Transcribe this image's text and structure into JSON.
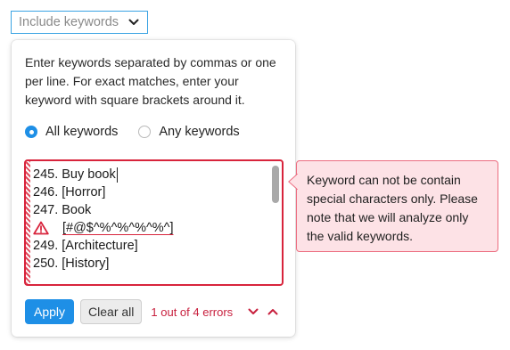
{
  "dropdown": {
    "label": "Include keywords",
    "icon": "chevron-down-icon"
  },
  "panel": {
    "instructions": "Enter keywords separated by commas or one per line. For exact matches, enter your keyword with square brackets around it.",
    "match_mode": {
      "selected": "All keywords",
      "options": [
        "All keywords",
        "Any keywords"
      ]
    },
    "keyword_lines": [
      {
        "text": "245. Buy book",
        "error": false,
        "cursor": true
      },
      {
        "text": "246. [Horror]",
        "error": false
      },
      {
        "text": "247. Book",
        "error": false
      },
      {
        "text": "[#@$^%^%^%^%^]",
        "error": true,
        "icon": "warning-icon"
      },
      {
        "text": "249. [Architecture]",
        "error": false
      },
      {
        "text": "250. [History]",
        "error": false
      }
    ],
    "footer": {
      "apply_label": "Apply",
      "clear_label": "Clear all",
      "error_count": "1 out of 4 errors",
      "next_icon": "chevron-down-icon",
      "prev_icon": "chevron-up-icon"
    }
  },
  "tooltip": {
    "text": "Keyword can not be contain special characters only. Please note that we will analyze only the valid keywords."
  },
  "colors": {
    "accent": "#1e8fe6",
    "error": "#d8243c",
    "tooltip_bg": "#fde2e6",
    "dropdown_border": "#3aa3e3"
  }
}
